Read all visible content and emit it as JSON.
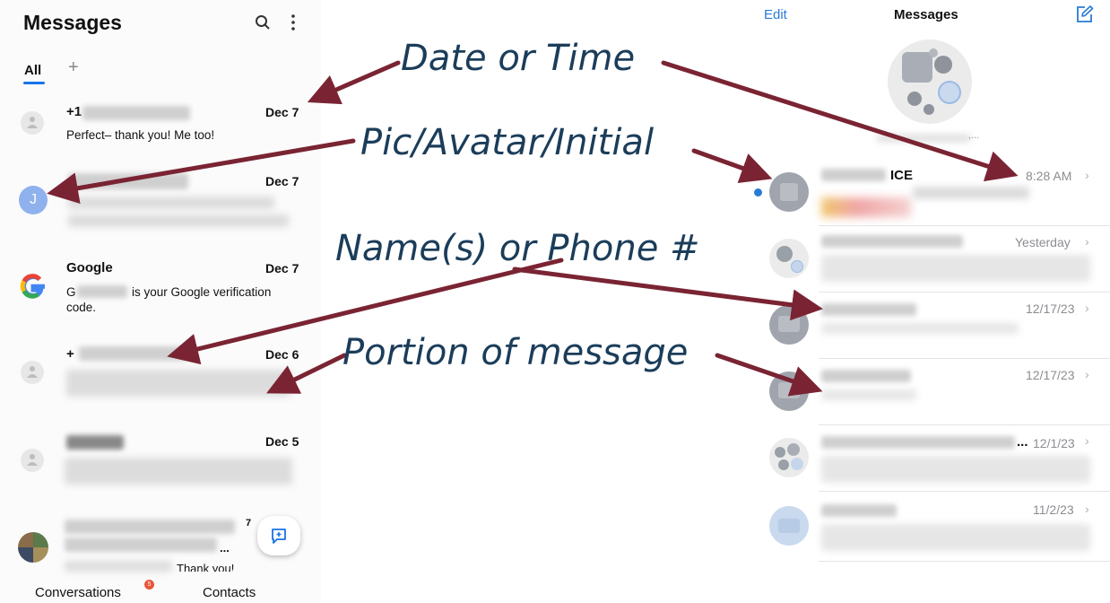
{
  "left_app": {
    "title": "Messages",
    "tabs": [
      {
        "label": "All"
      }
    ],
    "add_tab": "+",
    "conversations": [
      {
        "name": "+1",
        "date": "Dec 7",
        "preview": "Perfect– thank you! Me too!"
      },
      {
        "initial": "J",
        "date": "Dec 7"
      },
      {
        "name": "Google",
        "date": "Dec 7",
        "preview_prefix": "G",
        "preview_rest": "is your Google verification",
        "preview_line2": "code."
      },
      {
        "name": "+",
        "date": "Dec 6"
      },
      {
        "date": "Dec 5"
      },
      {
        "unread": "7",
        "tail": "...",
        "preview_end": "Thank you!"
      }
    ],
    "bottom_nav": {
      "conversations": "Conversations",
      "conversations_badge": "5",
      "contacts": "Contacts"
    }
  },
  "right_app": {
    "edit": "Edit",
    "title": "Messages",
    "rows": [
      {
        "name_suffix": "ICE",
        "time": "8:28 AM",
        "unread": true
      },
      {
        "time": "Yesterday"
      },
      {
        "time": "12/17/23"
      },
      {
        "time": "12/17/23"
      },
      {
        "ellipsis": "...",
        "time": "12/1/23"
      },
      {
        "time": "11/2/23"
      }
    ],
    "group_caption": ",..."
  },
  "annotations": {
    "date_or_time": "Date or Time",
    "avatar": "Pic/Avatar/Initial",
    "names": "Name(s) or Phone #",
    "portion": "Portion of message"
  },
  "colors": {
    "arrow": "#7a2433",
    "annotation_text": "#1b3d5a",
    "ios_blue": "#2a7bd6",
    "android_blue": "#1a73e8"
  }
}
